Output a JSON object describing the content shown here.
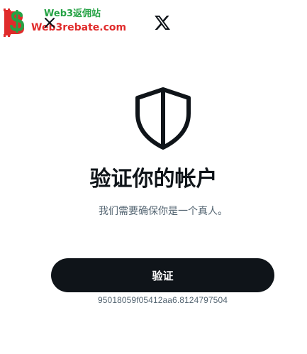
{
  "watermark": {
    "line1": "Web3返佣站",
    "line2": "Web3rebate.com",
    "colors": {
      "line1": "#25a244",
      "line2": "#e02b2b"
    }
  },
  "header": {
    "close_icon": "close-icon",
    "logo_icon": "x-logo-icon"
  },
  "main": {
    "icon": "shield-icon",
    "title": "验证你的帐户",
    "subtitle": "我们需要确保你是一个真人。",
    "verify_label": "验证",
    "session_id": "95018059f05412aa6.8124797504"
  },
  "colors": {
    "text_primary": "#0f1419",
    "text_secondary": "#536471",
    "button_bg": "#0f1419",
    "button_text": "#ffffff",
    "background": "#ffffff"
  }
}
